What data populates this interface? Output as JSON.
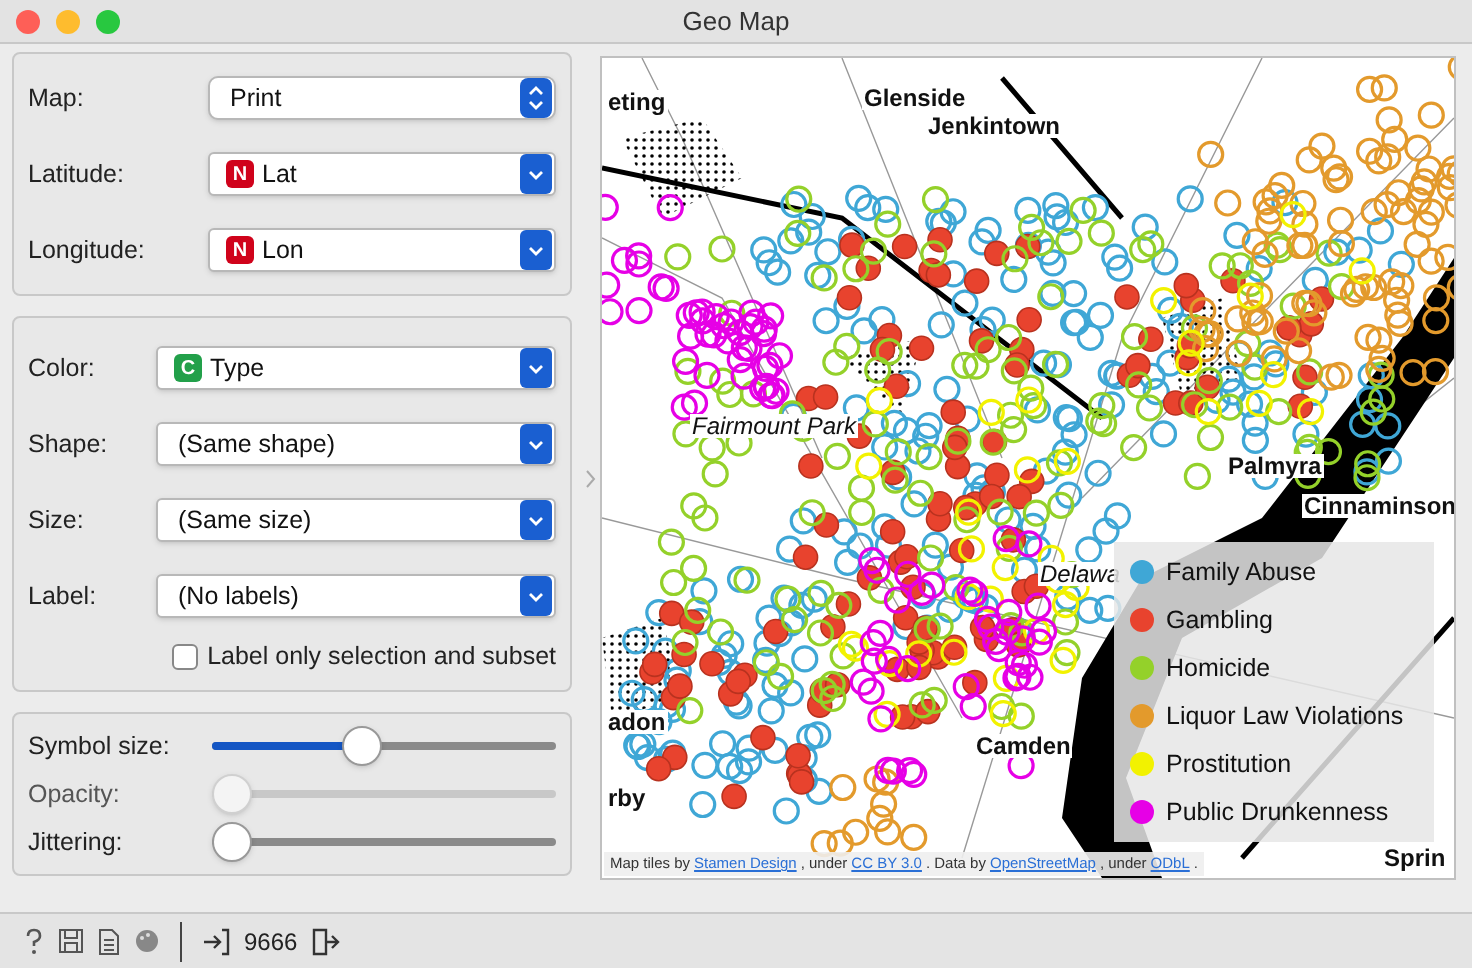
{
  "window": {
    "title": "Geo Map"
  },
  "map_settings": [
    {
      "label": "Map:",
      "value": "Print",
      "kind": "stepper"
    },
    {
      "label": "Latitude:",
      "value": "Lat",
      "badge": "N",
      "color": "#d0021b",
      "kind": "combo"
    },
    {
      "label": "Longitude:",
      "value": "Lon",
      "badge": "N",
      "color": "#d0021b",
      "kind": "combo"
    }
  ],
  "appearance": [
    {
      "label": "Color:",
      "value": "Type",
      "badge": "C",
      "color": "#22a04a",
      "kind": "combo"
    },
    {
      "label": "Shape:",
      "value": "(Same shape)",
      "kind": "combo"
    },
    {
      "label": "Size:",
      "value": "(Same size)",
      "kind": "combo"
    },
    {
      "label": "Label:",
      "value": "(No labels)",
      "kind": "combo"
    }
  ],
  "label_only": {
    "label": "Label only selection and subset",
    "checked": false
  },
  "sliders": [
    {
      "label": "Symbol size:",
      "level": 0.43,
      "disabled": false
    },
    {
      "label": "Opacity:",
      "level": 0,
      "disabled": true
    },
    {
      "label": "Jittering:",
      "level": 0,
      "disabled": false
    }
  ],
  "map": {
    "place_labels": [
      "eting",
      "Glenside",
      "Jenkintown",
      "Fairmount Park",
      "Palmyra",
      "Cinnaminson",
      "Delawa",
      "adon",
      "rby",
      "Camden",
      "Sprin"
    ],
    "legend": [
      {
        "label": "Family Abuse",
        "color": "#3fa7d6"
      },
      {
        "label": "Gambling",
        "color": "#e8432e"
      },
      {
        "label": "Homicide",
        "color": "#94d12a"
      },
      {
        "label": "Liquor Law Violations",
        "color": "#e39a2c"
      },
      {
        "label": "Prostitution",
        "color": "#f2f200"
      },
      {
        "label": "Public Drunkenness",
        "color": "#e600e6"
      }
    ],
    "attribution": [
      {
        "text": "Map tiles by",
        "kind": "text"
      },
      {
        "text": "Stamen Design",
        "kind": "link"
      },
      {
        "text": ", under",
        "kind": "text"
      },
      {
        "text": "CC BY 3.0",
        "kind": "link"
      },
      {
        "text": ". Data by",
        "kind": "text"
      },
      {
        "text": "OpenStreetMap",
        "kind": "link"
      },
      {
        "text": ", under",
        "kind": "text"
      },
      {
        "text": "ODbL",
        "kind": "link"
      },
      {
        "text": ".",
        "kind": "text"
      }
    ]
  },
  "status_bar": {
    "count": "9666"
  }
}
